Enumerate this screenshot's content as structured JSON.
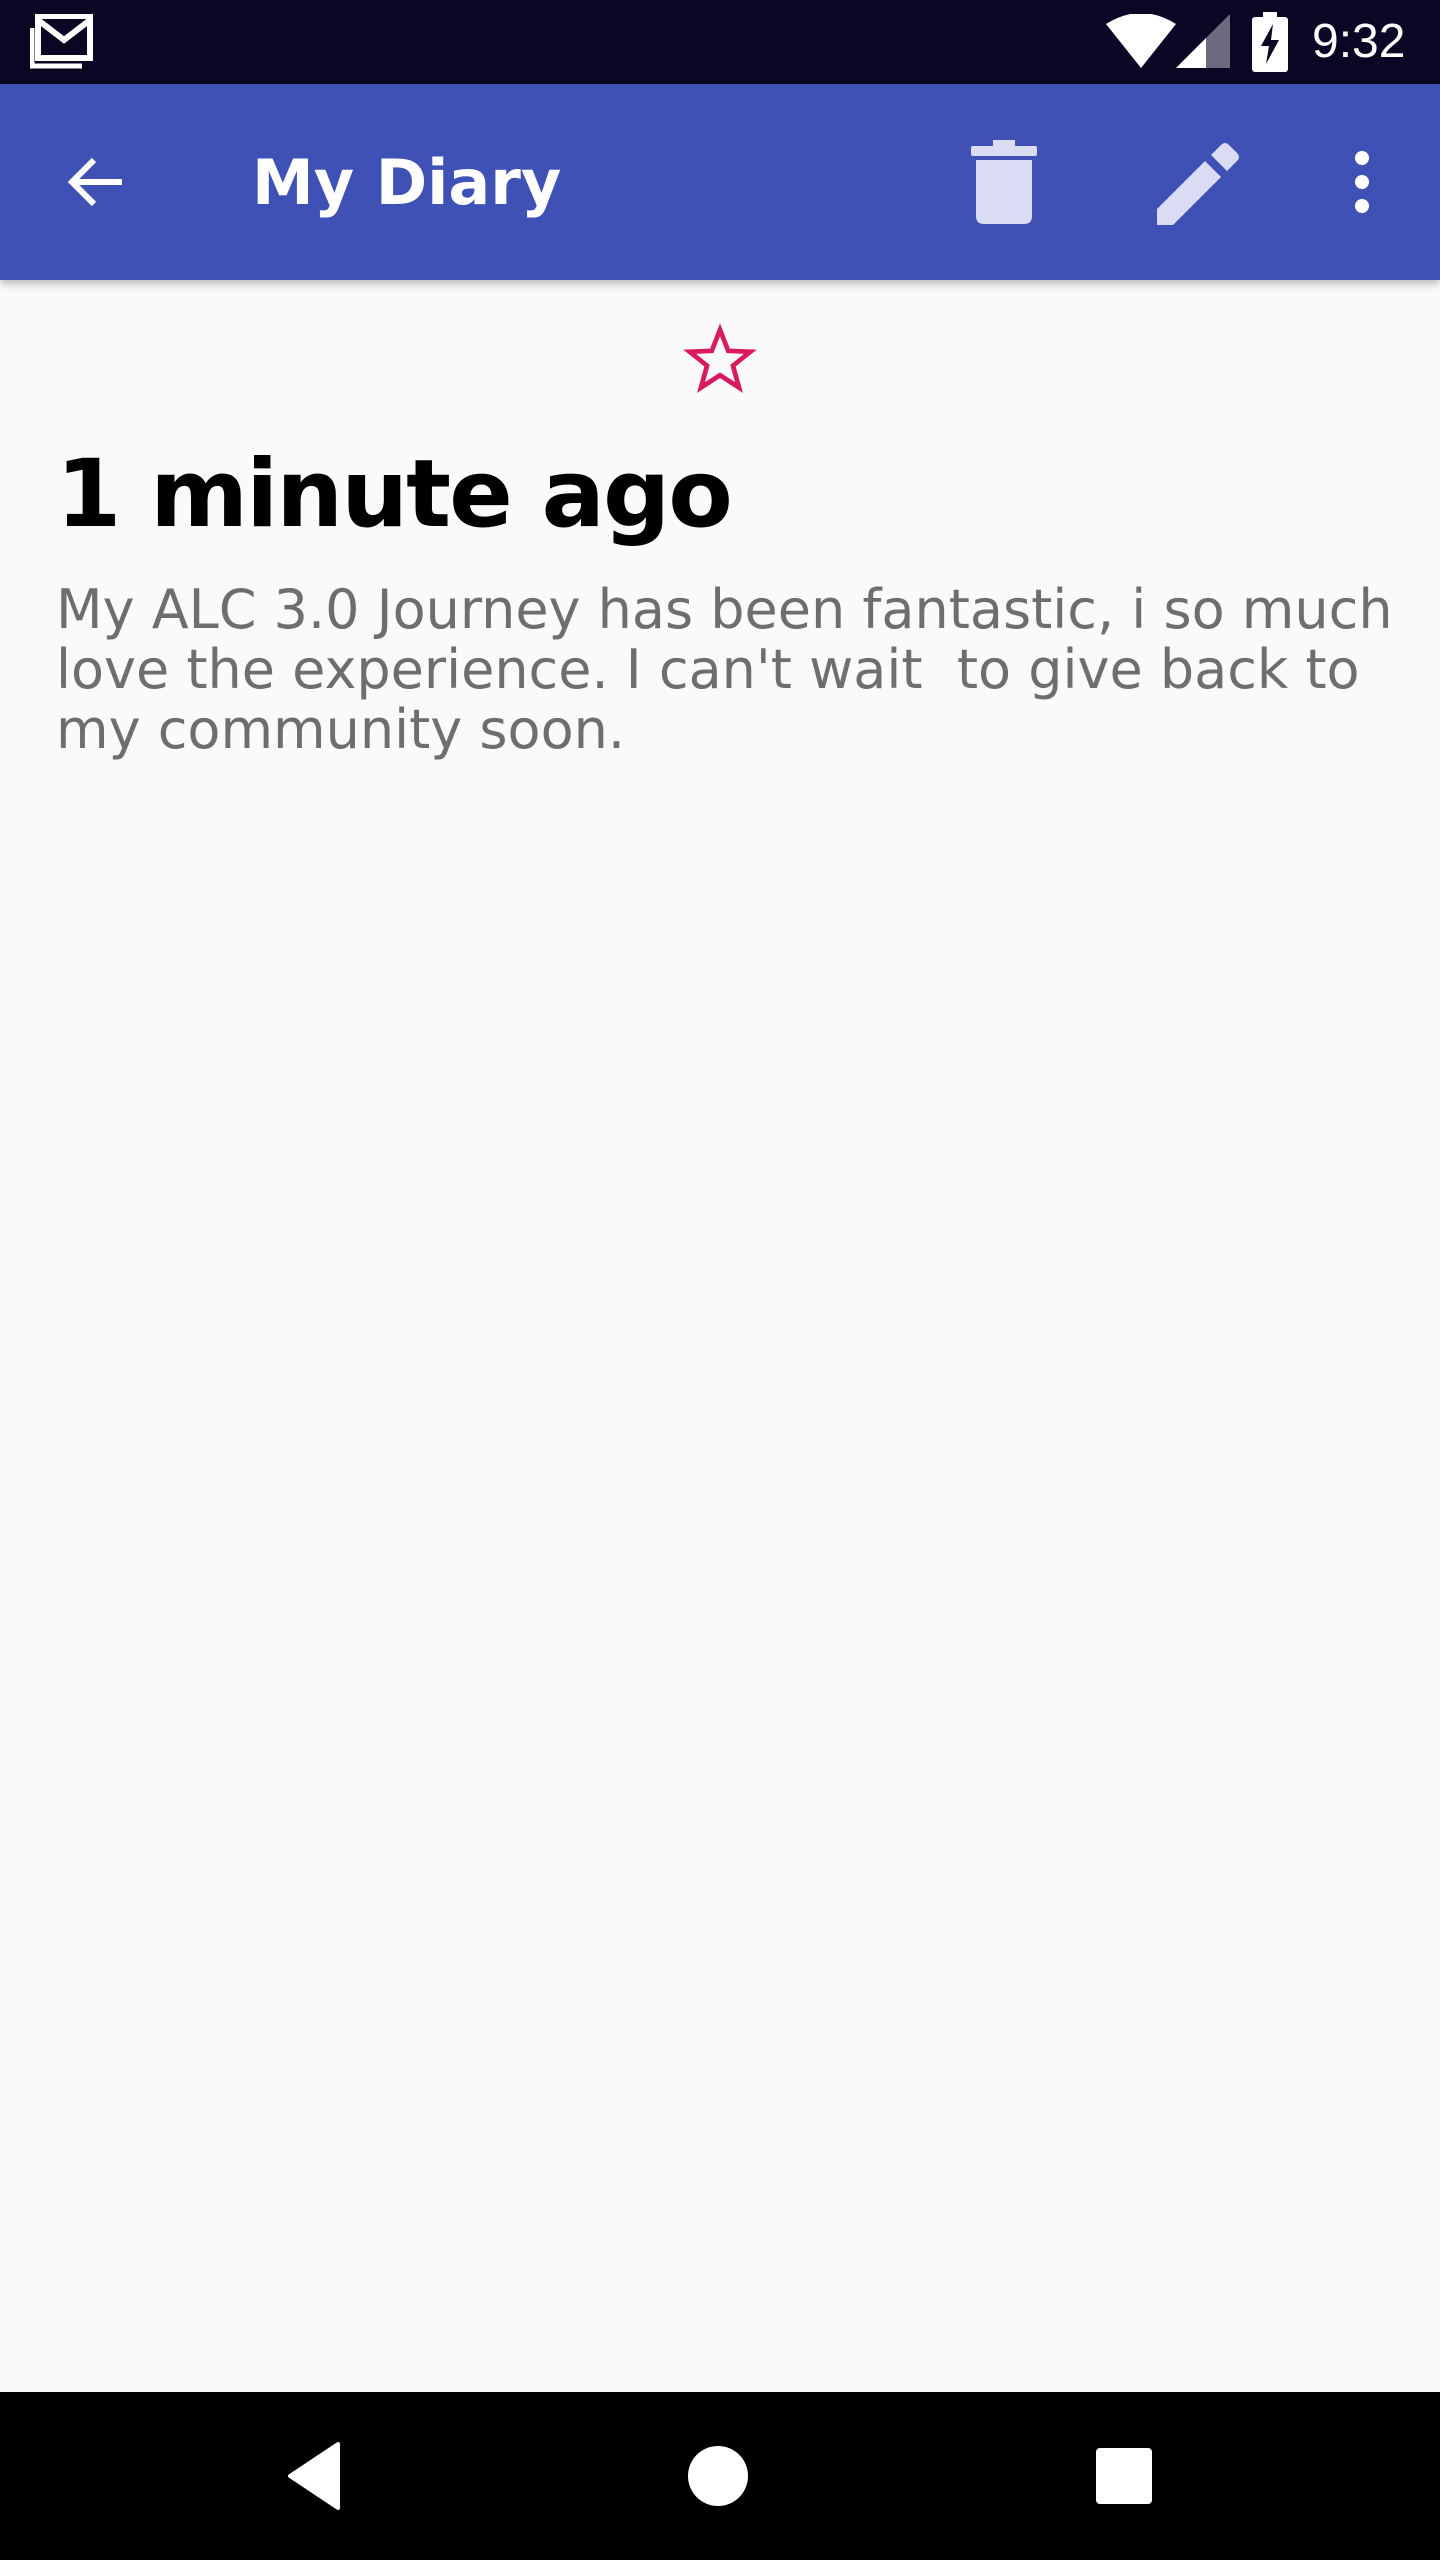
{
  "status_bar": {
    "time": "9:32",
    "icons": [
      "gmail-icon",
      "wifi-icon",
      "signal-icon",
      "battery-charging-icon"
    ]
  },
  "app_bar": {
    "title": "My Diary",
    "actions": [
      "back-arrow-icon",
      "delete-icon",
      "edit-icon",
      "more-vert-icon"
    ]
  },
  "entry": {
    "favorite_icon": "star-outline-icon",
    "time": "1 minute ago",
    "body": "My ALC 3.0 Journey has been fantastic, i so much love the experience. I can't wait  to give back to my community soon."
  },
  "nav_bar": {
    "buttons": [
      "nav-back-icon",
      "nav-home-icon",
      "nav-recents-icon"
    ]
  },
  "colors": {
    "status_bar": "#0b0623",
    "app_bar": "#3f51b5",
    "app_bar_icon": "#d9dcf2",
    "star": "#d81b60",
    "background": "#fafafa",
    "body_text": "#6e6e6e"
  }
}
